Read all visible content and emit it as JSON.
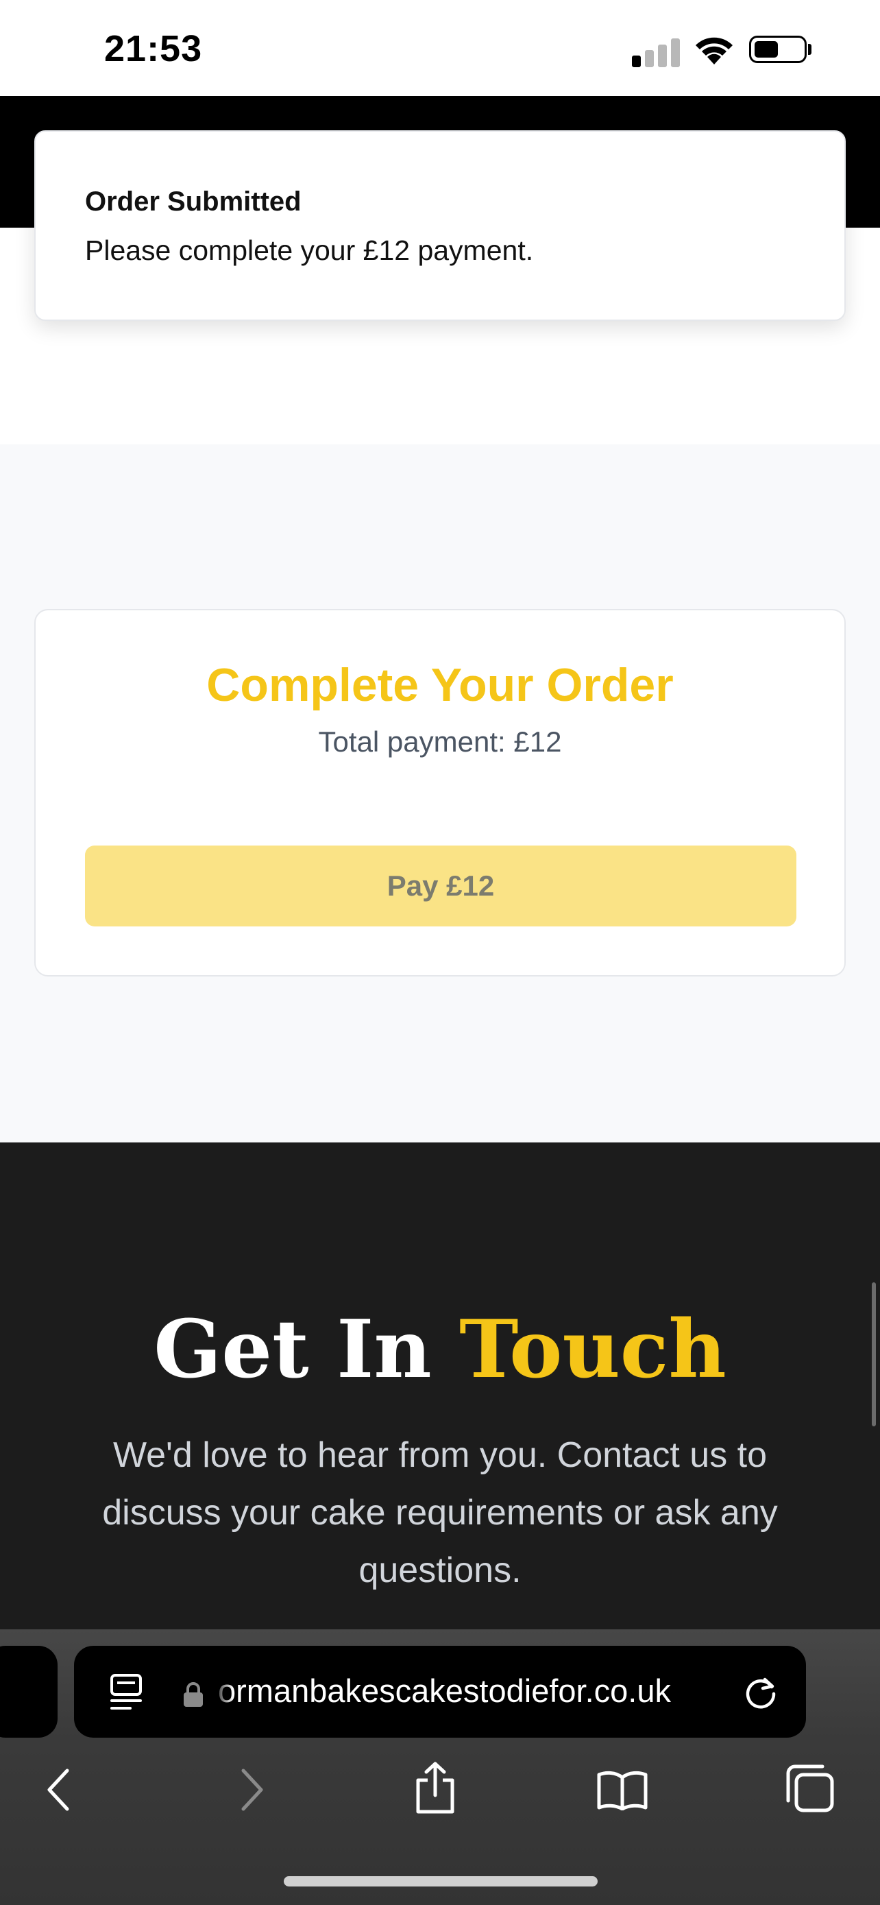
{
  "status_bar": {
    "time": "21:53",
    "icons": [
      "cellular-signal-icon",
      "wifi-icon",
      "battery-icon"
    ]
  },
  "toast": {
    "title": "Order Submitted",
    "description": "Please complete your £12 payment."
  },
  "payment": {
    "title": "Complete Your Order",
    "total_label": "Total payment: £12",
    "pay_button": "Pay £12"
  },
  "contact": {
    "heading_part1": "Get In",
    "heading_part2": "Touch",
    "text": "We'd love to hear from you. Contact us to discuss your cake requirements or ask any questions."
  },
  "browser": {
    "url": "ormanbakescakestodiefor.co.uk",
    "toolbar_icons": [
      "back-icon",
      "forward-icon",
      "share-icon",
      "bookmarks-icon",
      "tabs-icon"
    ]
  },
  "colors": {
    "accent": "#f5c518",
    "pay_button_bg": "#fae386",
    "dark_section": "#1c1c1c"
  }
}
